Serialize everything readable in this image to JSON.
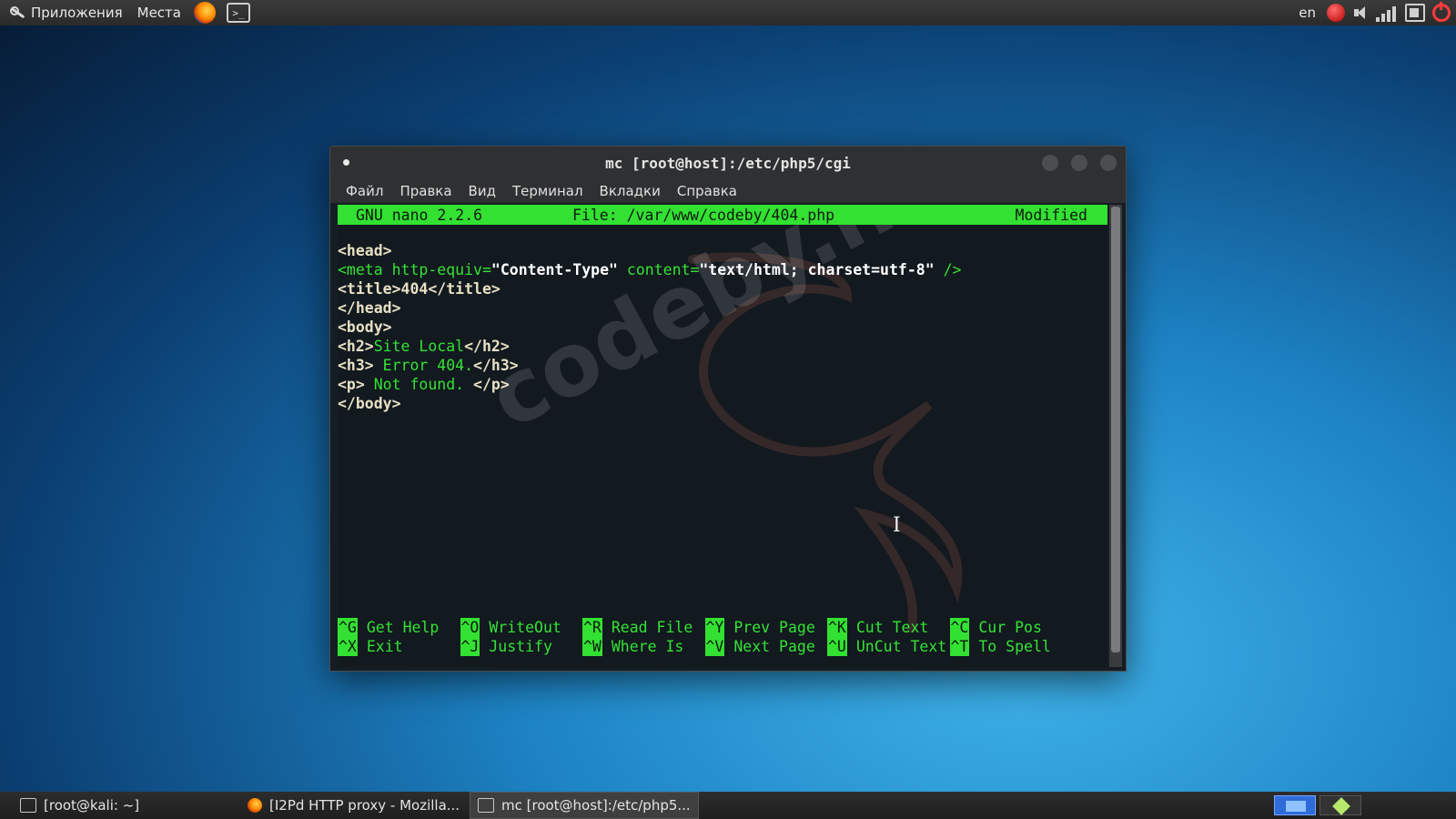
{
  "top_panel": {
    "apps_label": "Приложения",
    "places_label": "Места",
    "terminal_glyph": ">_",
    "lang": "en"
  },
  "window": {
    "title": "mc [root@host]:/etc/php5/cgi",
    "menu": [
      "Файл",
      "Правка",
      "Вид",
      "Терминал",
      "Вкладки",
      "Справка"
    ]
  },
  "nano": {
    "version": "GNU nano 2.2.6",
    "file": "File: /var/www/codeby/404.php",
    "status": "Modified",
    "lines": [
      [
        {
          "t": "<head>",
          "c": "tag"
        }
      ],
      [
        {
          "t": "<meta ",
          "c": "attr"
        },
        {
          "t": "http-equiv=",
          "c": "attr"
        },
        {
          "t": "\"Content-Type\"",
          "c": "str"
        },
        {
          "t": " content=",
          "c": "attr"
        },
        {
          "t": "\"text/html; charset=utf-8\"",
          "c": "str"
        },
        {
          "t": " />",
          "c": "attr"
        }
      ],
      [
        {
          "t": "<title>404</title>",
          "c": "tag"
        }
      ],
      [
        {
          "t": "</head>",
          "c": "tag"
        }
      ],
      [
        {
          "t": "<body>",
          "c": "tag"
        }
      ],
      [
        {
          "t": "<h2>",
          "c": "tag"
        },
        {
          "t": "Site Local",
          "c": "txt"
        },
        {
          "t": "</h2>",
          "c": "tag"
        }
      ],
      [
        {
          "t": "<h3>",
          "c": "tag"
        },
        {
          "t": " Error 404.",
          "c": "txt"
        },
        {
          "t": "</h3>",
          "c": "tag"
        }
      ],
      [
        {
          "t": "<p>",
          "c": "tag"
        },
        {
          "t": " Not found. ",
          "c": "txt"
        },
        {
          "t": "</p>",
          "c": "tag"
        }
      ],
      [
        {
          "t": "</body>",
          "c": "tag"
        }
      ]
    ],
    "shortcuts_row1": [
      {
        "key": "^G",
        "label": "Get Help"
      },
      {
        "key": "^O",
        "label": "WriteOut"
      },
      {
        "key": "^R",
        "label": "Read File"
      },
      {
        "key": "^Y",
        "label": "Prev Page"
      },
      {
        "key": "^K",
        "label": "Cut Text"
      },
      {
        "key": "^C",
        "label": "Cur Pos"
      }
    ],
    "shortcuts_row2": [
      {
        "key": "^X",
        "label": "Exit"
      },
      {
        "key": "^J",
        "label": "Justify"
      },
      {
        "key": "^W",
        "label": "Where Is"
      },
      {
        "key": "^V",
        "label": "Next Page"
      },
      {
        "key": "^U",
        "label": "UnCut Text"
      },
      {
        "key": "^T",
        "label": "To Spell"
      }
    ]
  },
  "watermark": "codeby.net",
  "taskbar": {
    "tasks": [
      {
        "label": "[root@kali: ~]",
        "icon": "terminal-icon"
      },
      {
        "label": "[I2Pd HTTP proxy - Mozilla...",
        "icon": "firefox-icon"
      },
      {
        "label": "mc [root@host]:/etc/php5...",
        "icon": "terminal-icon"
      }
    ]
  },
  "colors": {
    "nano_green": "#32e132",
    "terminal_bg": "#12191f",
    "power_red": "#ff3b3b"
  }
}
